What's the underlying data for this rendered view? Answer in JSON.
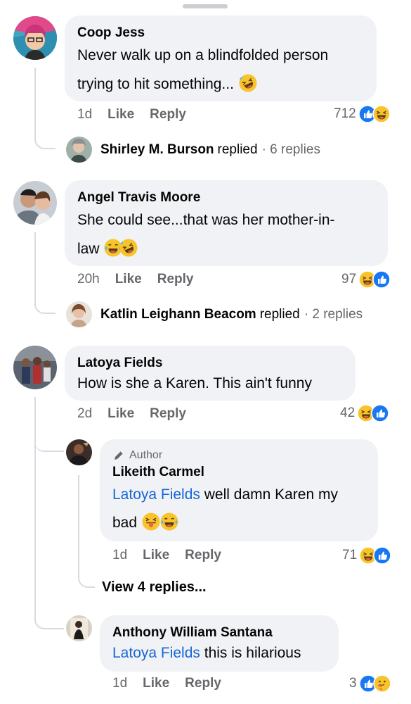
{
  "comments": [
    {
      "author": "Coop Jess",
      "text_line1": "Never walk up on a blindfolded person",
      "text_line2": "trying to hit something...",
      "time": "1d",
      "like": "Like",
      "reply": "Reply",
      "reaction_count": "712",
      "replied_by": "Shirley M. Burson",
      "replied_word": "replied",
      "replies_count": "· 6 replies"
    },
    {
      "author": "Angel Travis Moore",
      "text_line1": "She could see...that was her mother-in-",
      "text_line2": "law",
      "time": "20h",
      "like": "Like",
      "reply": "Reply",
      "reaction_count": "97",
      "replied_by": "Katlin Leighann Beacom",
      "replied_word": "replied",
      "replies_count": "· 2 replies"
    },
    {
      "author": "Latoya Fields",
      "text_line1": "How is she a Karen. This ain't funny",
      "time": "2d",
      "like": "Like",
      "reply": "Reply",
      "reaction_count": "42"
    }
  ],
  "replies": [
    {
      "author_tag": "Author",
      "author": "Likeith Carmel",
      "mention": "Latoya Fields",
      "text_line1": "well damn Karen my",
      "text_line2": "bad",
      "time": "1d",
      "like": "Like",
      "reply": "Reply",
      "reaction_count": "71",
      "view_replies": "View 4 replies..."
    },
    {
      "author": "Anthony William Santana",
      "mention": "Latoya Fields",
      "text": "this is hilarious",
      "time": "1d",
      "like": "Like",
      "reply": "Reply",
      "reaction_count": "3"
    }
  ],
  "icons": {
    "like": "thumbs-up-reaction-icon",
    "haha": "laughing-reaction-icon",
    "care": "care-reaction-icon",
    "rofl": "rolling-on-floor-laughing-emoji",
    "joy": "tears-of-joy-emoji",
    "tongue": "winking-tongue-emoji",
    "author": "pencil-icon"
  },
  "colors": {
    "like_blue": "#1877f2",
    "mention_blue": "#1866d6",
    "bubble_bg": "#f0f2f5",
    "meta_gray": "#65676b",
    "emoji_yellow": "#f7c42b"
  }
}
